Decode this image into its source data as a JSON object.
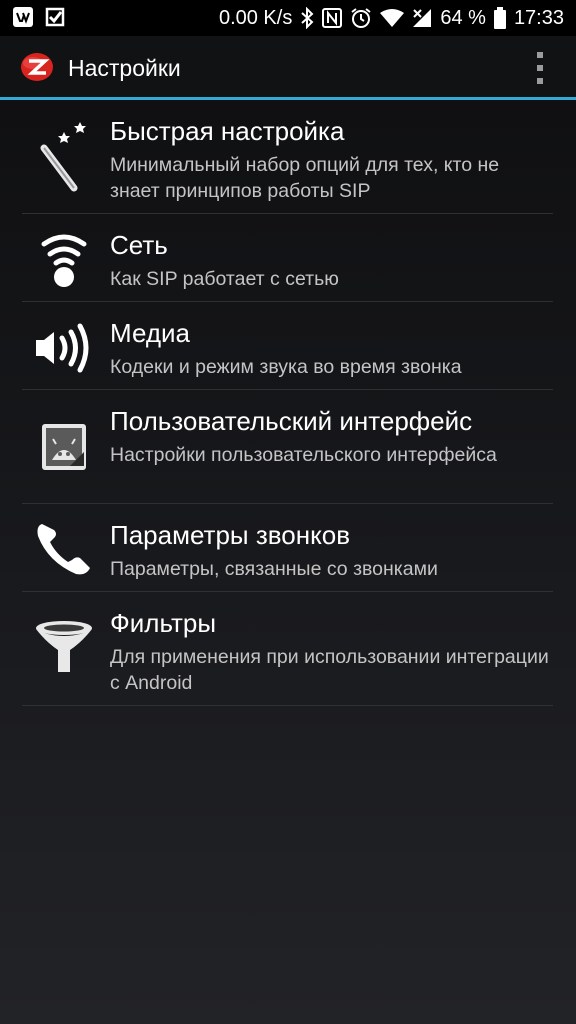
{
  "status_bar": {
    "speed": "0.00 K/s",
    "battery": "64 %",
    "time": "17:33",
    "icons": [
      "vk-icon",
      "download-check-icon",
      "bluetooth-icon",
      "nfc-icon",
      "alarm-icon",
      "wifi-icon",
      "signal-icon",
      "battery-icon"
    ]
  },
  "action_bar": {
    "title": "Настройки",
    "accent_color": "#35a8d4"
  },
  "settings": [
    {
      "title": "Быстрая настройка",
      "summary": "Минимальный набор опций для тех, кто не знает принципов работы SIP",
      "icon": "magic-wand-icon"
    },
    {
      "title": "Сеть",
      "summary": "Как SIP работает с сетью",
      "icon": "wifi-network-icon"
    },
    {
      "title": "Медиа",
      "summary": "Кодеки и режим звука во время звонка",
      "icon": "speaker-icon"
    },
    {
      "title": "Пользовательский интерфейс",
      "summary": "Настройки пользовательского интерфейса",
      "icon": "android-ui-icon"
    },
    {
      "title": "Параметры звонков",
      "summary": "Параметры, связанные со звонками",
      "icon": "phone-icon"
    },
    {
      "title": "Фильтры",
      "summary": "Для применения при использовании интеграции с Android",
      "icon": "filter-funnel-icon"
    }
  ]
}
